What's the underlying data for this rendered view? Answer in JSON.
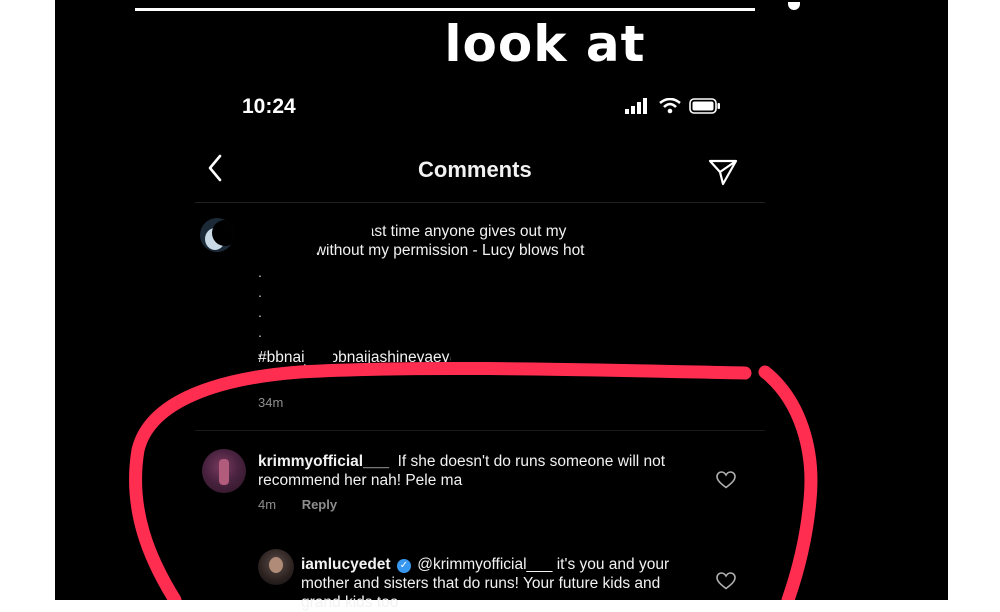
{
  "story": {
    "caption": "look at"
  },
  "status_bar": {
    "time": "10:24"
  },
  "header": {
    "title": "Comments"
  },
  "post": {
    "caption_lines": [
      "this be this the last time anyone gives out my",
      "number without my permission - Lucy blows hot"
    ],
    "dots": [
      ".",
      ".",
      ".",
      ".",
      "."
    ],
    "hashtags": "#bbnaija #bbnaijashineyaeye #bbnaijaupdates",
    "time": "34m"
  },
  "comments": [
    {
      "username": "krimmyofficial___",
      "verified": false,
      "text": "If she doesn't do runs someone will not recommend her nah! Pele ma",
      "time": "4m",
      "reply_label": "Reply"
    },
    {
      "username": "iamlucyedet",
      "verified": true,
      "mention": "@krimmyofficial___",
      "text": "it's you and your mother and sisters that do runs! Your future kids and grand kids too"
    }
  ],
  "icons": {
    "back": "chevron-left-icon",
    "share": "paper-plane-icon",
    "like": "heart-icon",
    "signal": "signal-icon",
    "wifi": "wifi-icon",
    "battery": "battery-icon"
  },
  "colors": {
    "background": "#000000",
    "text": "#f2f2f2",
    "muted": "#8e8e8e",
    "annotation": "#ff2d4f",
    "verified": "#3897f0"
  }
}
